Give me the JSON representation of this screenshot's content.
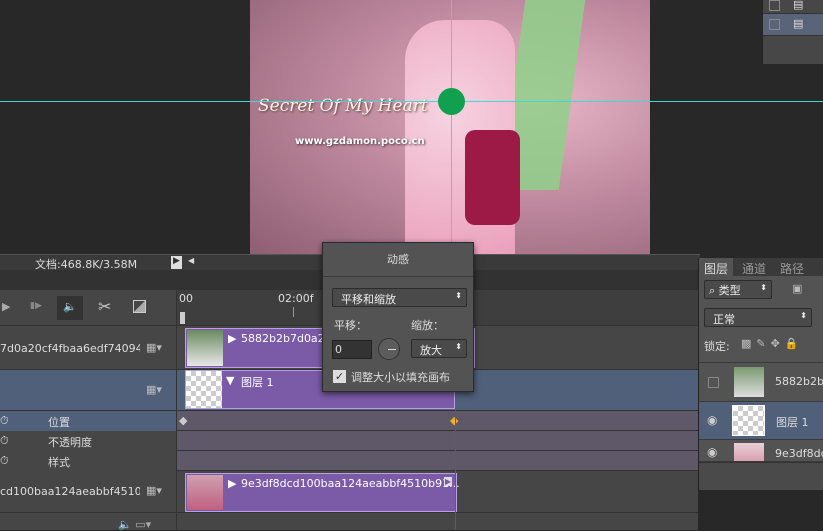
{
  "canvas": {
    "script_text": "Secret Of My Heart",
    "url_text": "www.gzdamon.poco.cn"
  },
  "status": {
    "doc_info": "文档:468.8K/3.58M"
  },
  "timeline": {
    "ruler": {
      "start": "00",
      "mark": "02:00f"
    },
    "tracks": [
      {
        "name": "7d0a20cf4fbaa6edf74094...",
        "clip": "5882b2b7d0a20"
      },
      {
        "name": "",
        "clip": "图层 1"
      },
      {
        "name": "cd100baa124aeabbf4510b...",
        "clip": "9e3df8dcd100baa124aeabbf4510b91..."
      }
    ],
    "properties": [
      "位置",
      "不透明度",
      "样式"
    ],
    "colors": {
      "clip": "#7b5ba8",
      "playhead": "#e0203c",
      "keyframe_active": "#f0b020"
    }
  },
  "dialog": {
    "title": "动感",
    "preset": "平移和缩放",
    "pan_label": "平移：",
    "zoom_label": "缩放：",
    "pan_value": "0",
    "zoom_value": "放大",
    "resize_label": "调整大小以填充画布",
    "resize_checked": true
  },
  "layers_panel": {
    "tabs": [
      "图层",
      "通道",
      "路径"
    ],
    "filter": "类型",
    "blend": "正常",
    "lock_label": "锁定:",
    "layers": [
      {
        "name": "5882b2b7",
        "visible": false
      },
      {
        "name": "图层 1",
        "visible": true,
        "selected": true
      },
      {
        "name": "9e3df8dc",
        "visible": true
      }
    ]
  }
}
